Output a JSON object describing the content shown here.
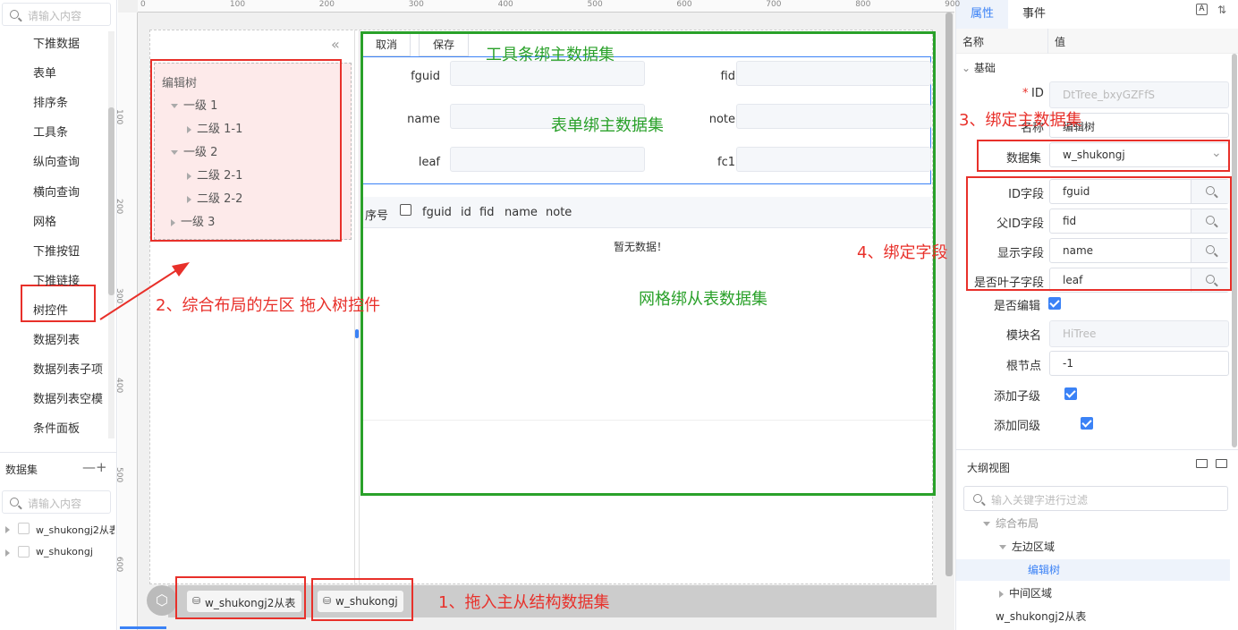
{
  "left_panel": {
    "search_placeholder": "请输入内容",
    "components": [
      "下推数据",
      "表单",
      "排序条",
      "工具条",
      "纵向查询",
      "横向查询",
      "网格",
      "下推按钮",
      "下推链接",
      "树控件",
      "数据列表",
      "数据列表子项",
      "数据列表空模",
      "条件面板"
    ],
    "dataset_title": "数据集",
    "dataset_actions": "—+",
    "dataset_search_placeholder": "请输入内容",
    "datasets": [
      "w_shukongj2从表",
      "w_shukongj"
    ]
  },
  "ruler": {
    "top": [
      "0",
      "100",
      "200",
      "300",
      "400",
      "500",
      "600",
      "700",
      "800",
      "900"
    ],
    "left": [
      "100",
      "200",
      "300",
      "400",
      "500",
      "600"
    ]
  },
  "tree": {
    "collapse": "«",
    "title": "编辑树",
    "nodes": [
      {
        "label": "一级 1",
        "level": 1,
        "expanded": true
      },
      {
        "label": "二级 1-1",
        "level": 2,
        "expanded": false
      },
      {
        "label": "一级 2",
        "level": 1,
        "expanded": true
      },
      {
        "label": "二级 2-1",
        "level": 2,
        "expanded": false
      },
      {
        "label": "二级 2-2",
        "level": 2,
        "expanded": false
      },
      {
        "label": "一级 3",
        "level": 1,
        "expanded": false
      }
    ]
  },
  "toolbar": {
    "cancel": "取消",
    "save": "保存"
  },
  "form": {
    "fields": [
      {
        "label": "fguid"
      },
      {
        "label": "fid"
      },
      {
        "label": "name"
      },
      {
        "label": "note"
      },
      {
        "label": "leaf"
      },
      {
        "label": "fc1"
      }
    ]
  },
  "grid": {
    "columns": [
      "序号",
      "fguid",
      "id",
      "fid",
      "name",
      "note"
    ],
    "empty": "暂无数据！"
  },
  "dataset_chips": [
    "w_shukongj2从表",
    "w_shukongj"
  ],
  "annotations": {
    "step1": "1、拖入主从结构数据集",
    "step2": "2、综合布局的左区 拖入树控件",
    "step3": "3、绑定主数据集",
    "step4": "4、绑定字段",
    "toolbar_bind": "工具条绑主数据集",
    "form_bind": "表单绑主数据集",
    "grid_bind": "网格绑从表数据集"
  },
  "props": {
    "tabs": [
      "属性",
      "事件"
    ],
    "col_name": "名称",
    "col_value": "值",
    "group": "基础",
    "id_label": "ID",
    "id_required": "*",
    "id_value": "DtTree_bxyGZFfS",
    "name_label": "名称",
    "name_value": "编辑树",
    "dataset_label": "数据集",
    "dataset_value": "w_shukongj",
    "id_field_label": "ID字段",
    "id_field_value": "fguid",
    "pid_field_label": "父ID字段",
    "pid_field_value": "fid",
    "display_field_label": "显示字段",
    "display_field_value": "name",
    "leaf_field_label": "是否叶子字段",
    "leaf_field_value": "leaf",
    "editable_label": "是否编辑",
    "module_label": "模块名",
    "module_value": "HiTree",
    "root_label": "根节点",
    "root_value": "-1",
    "add_child_label": "添加子级",
    "add_sibling_label": "添加同级"
  },
  "outline": {
    "title": "大纲视图",
    "filter_placeholder": "输入关键字进行过滤",
    "items": [
      {
        "label": "综合布局",
        "level": 1
      },
      {
        "label": "左边区域",
        "level": 2
      },
      {
        "label": "编辑树",
        "level": 3,
        "selected": true
      },
      {
        "label": "中间区域",
        "level": 2
      },
      {
        "label": "w_shukongj2从表",
        "level": 0
      }
    ]
  },
  "colors": {
    "accent": "#3b82f6",
    "annotation_red": "#e8302a",
    "annotation_green": "#2aa12a"
  }
}
